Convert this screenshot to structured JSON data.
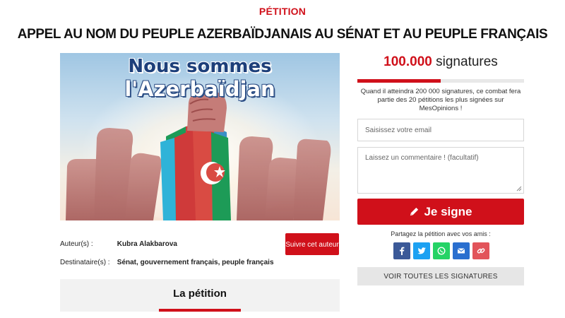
{
  "header": {
    "kicker": "PÉTITION",
    "title": "APPEL AU NOM DU PEUPLE AZERBAÏDJANAIS AU SÉNAT ET AU PEUPLE FRANÇAIS"
  },
  "hero": {
    "line1": "Nous sommes",
    "line2": "l'Azerbaïdjan"
  },
  "author": {
    "author_label": "Auteur(s) :",
    "author_value": "Kubra Alakbarova",
    "recipients_label": "Destinataire(s) :",
    "recipients_value": "Sénat, gouvernement français, peuple français",
    "follow_button": "Suivre cet auteur"
  },
  "tab": {
    "label": "La pétition"
  },
  "signatures": {
    "count": "100.000",
    "unit": "signatures",
    "progress_fraction": 0.5,
    "goal_text": "Quand il atteindra 200 000 signatures, ce combat fera partie des 20 pétitions les plus signées sur MesOpinions !"
  },
  "form": {
    "email_placeholder": "Saisissez votre email",
    "comment_placeholder": "Laissez un commentaire ! (facultatif)",
    "sign_button": "Je signe"
  },
  "share": {
    "label": "Partagez la pétition avec vos amis :",
    "buttons": [
      {
        "icon": "facebook-icon",
        "color": "#3b5998"
      },
      {
        "icon": "twitter-icon",
        "color": "#1da1f2"
      },
      {
        "icon": "whatsapp-icon",
        "color": "#25d366"
      },
      {
        "icon": "email-icon",
        "color": "#2a6fcf"
      },
      {
        "icon": "link-icon",
        "color": "#e2545a"
      }
    ]
  },
  "all_signatures_button": "VOIR TOUTES LES SIGNATURES",
  "colors": {
    "accent": "#d0101a",
    "tab_background": "#f2f2f2"
  }
}
